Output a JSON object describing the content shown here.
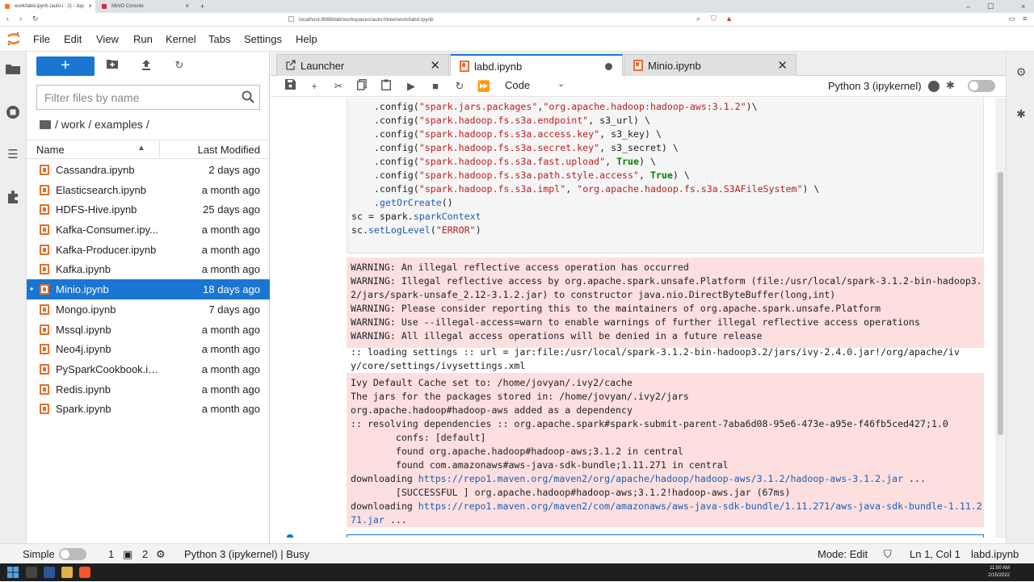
{
  "browser": {
    "tabs": [
      {
        "label": "work/labd.ipynb (auto-l : 2) - Jup"
      },
      {
        "label": "MinIO Console"
      }
    ],
    "url": "localhost:8888/lab/workspaces/auto-l/tree/work/labd.ipynb"
  },
  "menu": [
    "File",
    "Edit",
    "View",
    "Run",
    "Kernel",
    "Tabs",
    "Settings",
    "Help"
  ],
  "filebrowser": {
    "new_label": "+",
    "filter_placeholder": "Filter files by name",
    "breadcrumb": "/ work / examples /",
    "col_name": "Name",
    "col_modified": "Last Modified",
    "files": [
      {
        "name": "Cassandra.ipynb",
        "modified": "2 days ago"
      },
      {
        "name": "Elasticsearch.ipynb",
        "modified": "a month ago"
      },
      {
        "name": "HDFS-Hive.ipynb",
        "modified": "25 days ago"
      },
      {
        "name": "Kafka-Consumer.ipy...",
        "modified": "a month ago"
      },
      {
        "name": "Kafka-Producer.ipynb",
        "modified": "a month ago"
      },
      {
        "name": "Kafka.ipynb",
        "modified": "a month ago"
      },
      {
        "name": "Minio.ipynb",
        "modified": "18 days ago",
        "selected": true
      },
      {
        "name": "Mongo.ipynb",
        "modified": "7 days ago"
      },
      {
        "name": "Mssql.ipynb",
        "modified": "a month ago"
      },
      {
        "name": "Neo4j.ipynb",
        "modified": "a month ago"
      },
      {
        "name": "PySparkCookbook.ip...",
        "modified": "a month ago"
      },
      {
        "name": "Redis.ipynb",
        "modified": "a month ago"
      },
      {
        "name": "Spark.ipynb",
        "modified": "a month ago"
      }
    ]
  },
  "tabs": [
    {
      "label": "Launcher"
    },
    {
      "label": "labd.ipynb"
    },
    {
      "label": "Minio.ipynb"
    }
  ],
  "toolbar": {
    "cell_type": "Code",
    "kernel": "Python 3 (ipykernel)"
  },
  "output": {
    "warnings": "WARNING: An illegal reflective access operation has occurred\nWARNING: Illegal reflective access by org.apache.spark.unsafe.Platform (file:/usr/local/spark-3.1.2-bin-hadoop3.2/jars/spark-unsafe_2.12-3.1.2.jar) to constructor java.nio.DirectByteBuffer(long,int)\nWARNING: Please consider reporting this to the maintainers of org.apache.spark.unsafe.Platform\nWARNING: Use --illegal-access=warn to enable warnings of further illegal reflective access operations\nWARNING: All illegal access operations will be denied in a future release",
    "loading_line1": ":: loading settings :: url = jar:file:/usr/local/spark-3.1.2-bin-hadoop3.2/jars/ivy-2.4.0.jar!/org/apache/iv",
    "loading_line2": "y/core/settings/ivysettings.xml",
    "ivy_text": "Ivy Default Cache set to: /home/jovyan/.ivy2/cache\nThe jars for the packages stored in: /home/jovyan/.ivy2/jars\norg.apache.hadoop#hadoop-aws added as a dependency\n:: resolving dependencies :: org.apache.spark#spark-submit-parent-7aba6d08-95e6-473e-a95e-f46fb5ced427;1.0\n\tconfs: [default]\n\tfound org.apache.hadoop#hadoop-aws;3.1.2 in central\n\tfound com.amazonaws#aws-java-sdk-bundle;1.11.271 in central",
    "dl1_prefix": "downloading ",
    "dl1_url": "https://repo1.maven.org/maven2/org/apache/hadoop/hadoop-aws/3.1.2/hadoop-aws-3.1.2.jar",
    "dl1_suffix": " ...",
    "successful": "\t[SUCCESSFUL ] org.apache.hadoop#hadoop-aws;3.1.2!hadoop-aws.jar (67ms)",
    "dl2_prefix": "downloading ",
    "dl2_url": "https://repo1.maven.org/maven2/com/amazonaws/aws-java-sdk-bundle/1.11.271/aws-java-sdk-bundle-1.11.271.jar",
    "dl2_suffix": " ..."
  },
  "status": {
    "mode_label": "Simple",
    "count1": "1",
    "count2": "2",
    "kernel_status": "Python 3 (ipykernel) | Busy",
    "edit_mode": "Mode: Edit",
    "cursor": "Ln 1, Col 1",
    "filename": "labd.ipynb"
  },
  "taskbar": {
    "time": "11:50 AM",
    "date": "2/15/2022"
  },
  "colors": {
    "accent": "#1976d2",
    "output_bg": "#fddfe0",
    "notebook_icon": "#e46e2e"
  }
}
